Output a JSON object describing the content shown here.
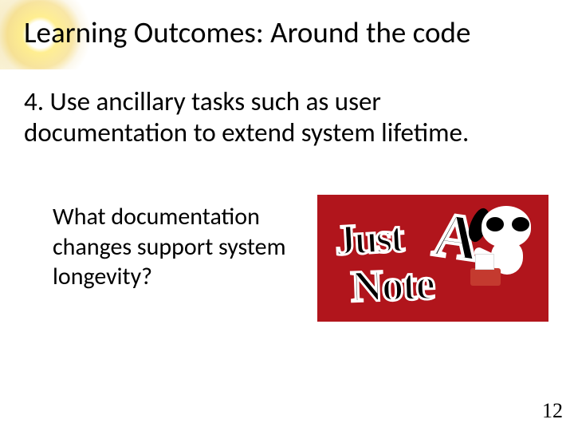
{
  "title": "Learning Outcomes: Around the code",
  "outcome": "4. Use ancillary tasks such as user documentation to extend system lifetime.",
  "question": "What documentation changes support system longevity?",
  "note_graphic": {
    "word_just": "Just",
    "word_a": "A",
    "word_note": "Note"
  },
  "page_number": "12"
}
